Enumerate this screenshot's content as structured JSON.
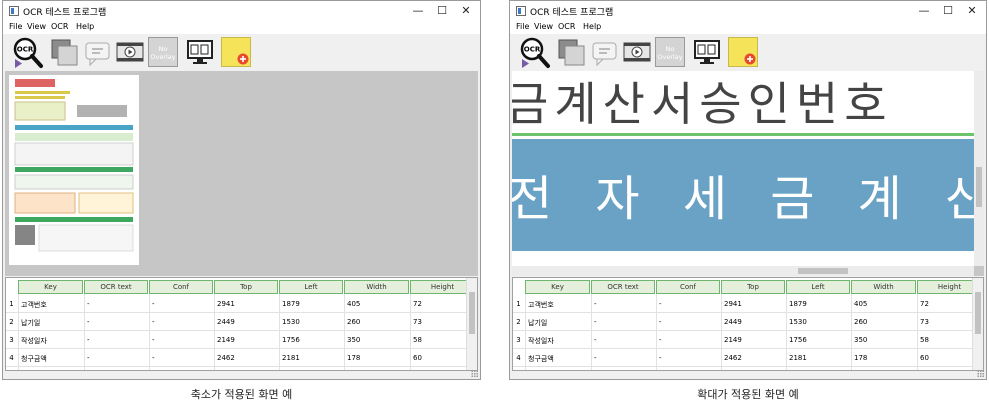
{
  "colors": {
    "accent_blue": "#3a78c8",
    "grid_header_bg": "#e4f0dc",
    "grid_header_border": "#6eb56e",
    "canvas_bg": "#c6c6c6",
    "sticky_yellow": "#f5e35a",
    "add_red": "#e84a2e"
  },
  "toolbar_icons": [
    "ocr-search-icon",
    "overlay-image-icon",
    "ocr-tooltip-icon",
    "film-play-icon",
    "no-overlay-icon",
    "monitor-ab-icon",
    "add-note-icon"
  ],
  "panels": [
    {
      "window_title": "OCR 테스트 프로그램",
      "window_buttons": {
        "minimize": "—",
        "maximize": "☐",
        "close": "✕"
      },
      "menu": [
        "File",
        "View",
        "OCR",
        "Help"
      ],
      "toolbar": {
        "ocr_label": "OCR",
        "no_overlay_line1": "No",
        "no_overlay_line2": "Overlay"
      },
      "columns": [
        "Key",
        "OCR text",
        "Conf",
        "Top",
        "Left",
        "Width",
        "Height"
      ],
      "rows": [
        [
          "1",
          "고객번호",
          "-",
          "-",
          "2941",
          "1879",
          "405",
          "72"
        ],
        [
          "2",
          "납기일",
          "-",
          "-",
          "2449",
          "1530",
          "260",
          "73"
        ],
        [
          "3",
          "작성일자",
          "-",
          "-",
          "2149",
          "1756",
          "350",
          "58"
        ],
        [
          "4",
          "청구금액",
          "-",
          "-",
          "2462",
          "2181",
          "178",
          "60"
        ]
      ],
      "caption": "축소가 적용된 화면 예"
    },
    {
      "window_title": "OCR 테스트 프로그램",
      "window_buttons": {
        "minimize": "—",
        "maximize": "☐",
        "close": "✕"
      },
      "menu": [
        "File",
        "View",
        "OCR",
        "Help"
      ],
      "toolbar": {
        "ocr_label": "OCR",
        "no_overlay_line1": "No",
        "no_overlay_line2": "Overlay"
      },
      "zoomed_text": {
        "line1": "금계산서승인번호",
        "line2": "전 자 세 금 계 산"
      },
      "columns": [
        "Key",
        "OCR text",
        "Conf",
        "Top",
        "Left",
        "Width",
        "Height"
      ],
      "rows": [
        [
          "1",
          "고객번호",
          "-",
          "-",
          "2941",
          "1879",
          "405",
          "72"
        ],
        [
          "2",
          "납기일",
          "-",
          "-",
          "2449",
          "1530",
          "260",
          "73"
        ],
        [
          "3",
          "작성일자",
          "-",
          "-",
          "2149",
          "1756",
          "350",
          "58"
        ],
        [
          "4",
          "청구금액",
          "-",
          "-",
          "2462",
          "2181",
          "178",
          "60"
        ]
      ],
      "caption": "확대가 적용된 화면 예"
    }
  ]
}
